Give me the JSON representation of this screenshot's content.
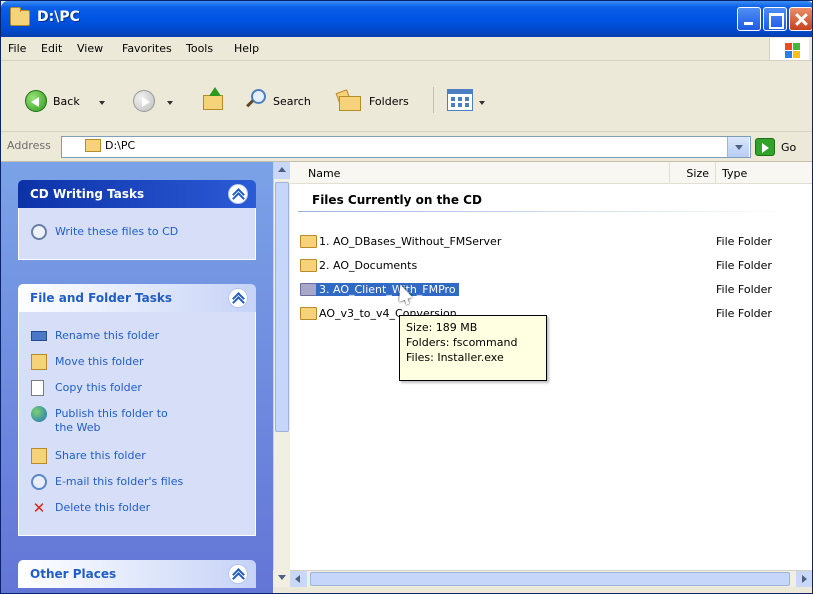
{
  "window": {
    "title": "D:\\PC"
  },
  "menu": [
    "File",
    "Edit",
    "View",
    "Favorites",
    "Tools",
    "Help"
  ],
  "toolbar": {
    "back_label": "Back",
    "search_label": "Search",
    "folders_label": "Folders"
  },
  "address": {
    "label": "Address",
    "value": "D:\\PC",
    "go_label": "Go"
  },
  "taskpane": {
    "cd_writing": {
      "title": "CD Writing Tasks",
      "items": [
        "Write these files to CD"
      ]
    },
    "file_folder": {
      "title": "File and Folder Tasks",
      "items": [
        "Rename this folder",
        "Move this folder",
        "Copy this folder",
        "Publish this folder to",
        "the Web",
        "Share this folder",
        "E-mail this folder's files",
        "Delete this folder"
      ]
    },
    "other_places": {
      "title": "Other Places"
    }
  },
  "filelist": {
    "columns": [
      "Name",
      "Size",
      "Type"
    ],
    "group_title": "Files Currently on the CD",
    "rows": [
      {
        "name": "1. AO_DBases_Without_FMServer",
        "type": "File Folder"
      },
      {
        "name": "2. AO_Documents",
        "type": "File Folder"
      },
      {
        "name": "3. AO_Client_With_FMPro",
        "type": "File Folder"
      },
      {
        "name": "AO_v3_to_v4_Conversion",
        "type": "File Folder"
      }
    ]
  },
  "tooltip": {
    "size": "Size: 189 MB",
    "folders": "Folders: fscommand",
    "files": "Files: Installer.exe"
  },
  "colors": {
    "title_bar": "#0054e3",
    "selection": "#316ac5",
    "task_link": "#215dc6"
  }
}
